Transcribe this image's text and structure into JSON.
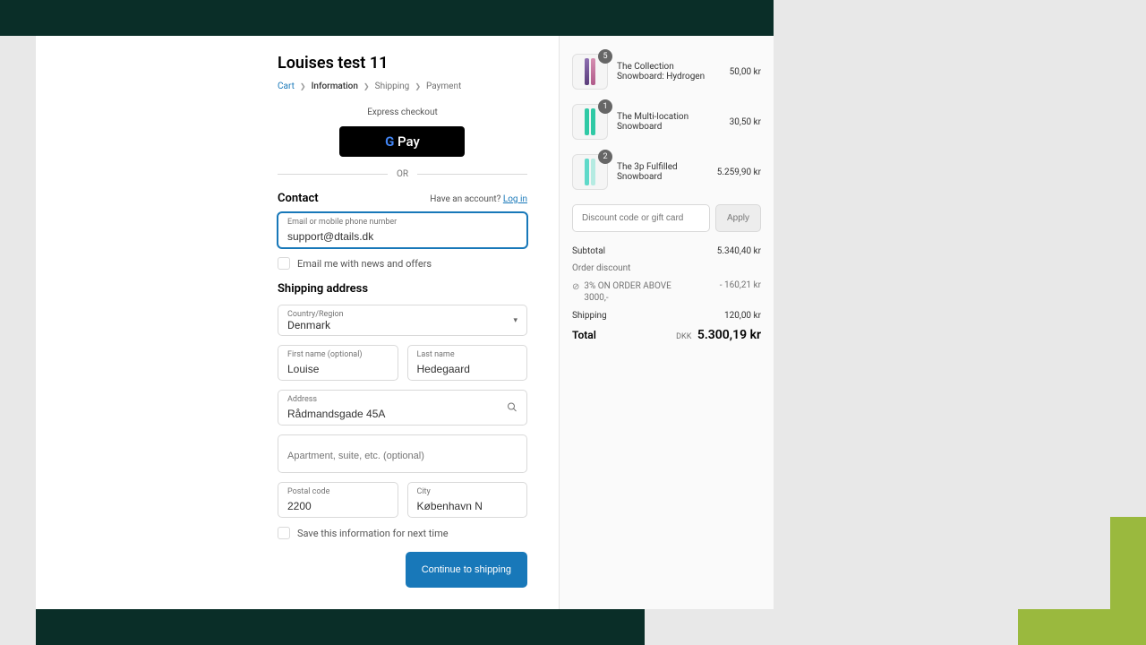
{
  "store_title": "Louises test 11",
  "breadcrumb": {
    "cart": "Cart",
    "information": "Information",
    "shipping": "Shipping",
    "payment": "Payment"
  },
  "express_label": "Express checkout",
  "gpay_label": "Pay",
  "divider_label": "OR",
  "contact": {
    "title": "Contact",
    "account_prompt": "Have an account?",
    "login_link": "Log in",
    "email_label": "Email or mobile phone number",
    "email_value": "support@dtails.dk",
    "news_offers": "Email me with news and offers"
  },
  "shipping_address_title": "Shipping address",
  "fields": {
    "country_label": "Country/Region",
    "country_value": "Denmark",
    "first_name_label": "First name (optional)",
    "first_name_value": "Louise",
    "last_name_label": "Last name",
    "last_name_value": "Hedegaard",
    "address_label": "Address",
    "address_value": "Rådmandsgade 45A",
    "apartment_placeholder": "Apartment, suite, etc. (optional)",
    "postal_label": "Postal code",
    "postal_value": "2200",
    "city_label": "City",
    "city_value": "København N",
    "save_info": "Save this information for next time"
  },
  "continue_button": "Continue to shipping",
  "cart": {
    "items": [
      {
        "qty": "5",
        "name": "The Collection Snowboard: Hydrogen",
        "price": "50,00 kr"
      },
      {
        "qty": "1",
        "name": "The Multi-location Snowboard",
        "price": "30,50 kr"
      },
      {
        "qty": "2",
        "name": "The 3p Fulfilled Snowboard",
        "price": "5.259,90 kr"
      }
    ],
    "discount_placeholder": "Discount code or gift card",
    "apply": "Apply",
    "subtotal_label": "Subtotal",
    "subtotal_value": "5.340,40 kr",
    "order_discount_label": "Order discount",
    "discount_name": "3% ON ORDER ABOVE 3000,-",
    "discount_value": "- 160,21 kr",
    "shipping_label": "Shipping",
    "shipping_value": "120,00 kr",
    "total_label": "Total",
    "total_currency": "DKK",
    "total_value": "5.300,19 kr"
  }
}
